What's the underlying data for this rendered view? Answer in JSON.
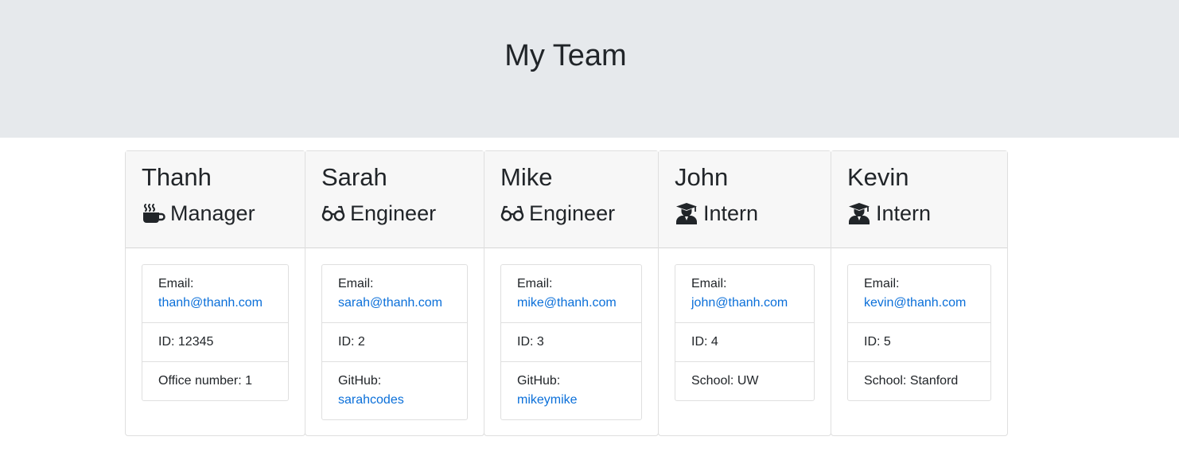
{
  "header": {
    "title": "My Team"
  },
  "team": [
    {
      "name": "Thanh",
      "role": "Manager",
      "role_icon": "coffee-icon",
      "email_label": "Email:",
      "email": "thanh@thanh.com",
      "id_text": "ID: 12345",
      "extra_label": "Office number: 1",
      "extra_link": ""
    },
    {
      "name": "Sarah",
      "role": "Engineer",
      "role_icon": "glasses-icon",
      "email_label": "Email:",
      "email": "sarah@thanh.com",
      "id_text": "ID: 2",
      "extra_label": "GitHub:",
      "extra_link": "sarahcodes"
    },
    {
      "name": "Mike",
      "role": "Engineer",
      "role_icon": "glasses-icon",
      "email_label": "Email:",
      "email": "mike@thanh.com",
      "id_text": "ID: 3",
      "extra_label": "GitHub:",
      "extra_link": "mikeymike"
    },
    {
      "name": "John",
      "role": "Intern",
      "role_icon": "graduate-icon",
      "email_label": "Email:",
      "email": "john@thanh.com",
      "id_text": "ID: 4",
      "extra_label": "School: UW",
      "extra_link": ""
    },
    {
      "name": "Kevin",
      "role": "Intern",
      "role_icon": "graduate-icon",
      "email_label": "Email:",
      "email": "kevin@thanh.com",
      "id_text": "ID: 5",
      "extra_label": "School: Stanford",
      "extra_link": ""
    }
  ],
  "colors": {
    "header_bg": "#e6e9ec",
    "card_header_bg": "#f7f7f7",
    "link": "#0a6fd9",
    "text": "#212529"
  }
}
